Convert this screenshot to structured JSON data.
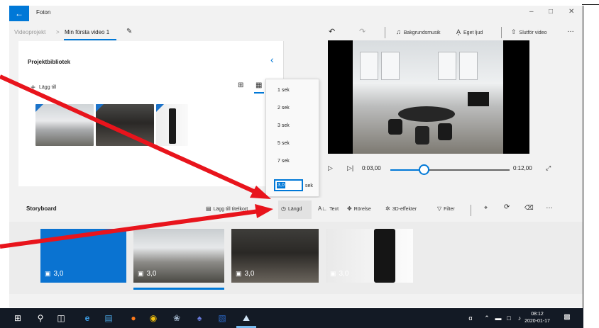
{
  "titlebar": {
    "back_icon": "back-arrow-icon",
    "app_title": "Foton",
    "minimize": "–",
    "maximize": "□",
    "close": "✕"
  },
  "breadcrumb": {
    "parent": "Videoprojekt",
    "separator": ">",
    "current": "Min första video 1"
  },
  "toolbar": {
    "undo": "↶",
    "redo": "↷",
    "music_icon": "♫",
    "music_label": "Bakgrundsmusik",
    "audio_icon": "A̧",
    "audio_label": "Eget ljud",
    "finish_icon": "⇧",
    "finish_label": "Slutför video",
    "more": "…"
  },
  "library": {
    "title": "Projektbibliotek",
    "add_label": "Lägg till",
    "collapse": "‹"
  },
  "playback": {
    "current_time": "0:03,00",
    "total_time": "0:12,00",
    "progress_fraction": 0.25
  },
  "duration_menu": {
    "options": [
      "1 sek",
      "2 sek",
      "3 sek",
      "5 sek",
      "7 sek"
    ],
    "input_value": "3,0",
    "unit": "sek"
  },
  "storyboard": {
    "title": "Storyboard",
    "add_title_card": "Lägg till titelkort",
    "duration": "Längd",
    "text": "Text",
    "motion": "Rörelse",
    "effects_3d": "3D-effekter",
    "filter": "Filter",
    "more": "…",
    "clips": [
      {
        "duration": "3,0"
      },
      {
        "duration": "3,0"
      },
      {
        "duration": "3,0"
      },
      {
        "duration": "3,0"
      }
    ]
  },
  "taskbar": {
    "time": "08:12",
    "date": "2020-01-17"
  },
  "colors": {
    "accent": "#0078d7",
    "arrow": "#e8141c",
    "taskbar": "#131a25"
  }
}
